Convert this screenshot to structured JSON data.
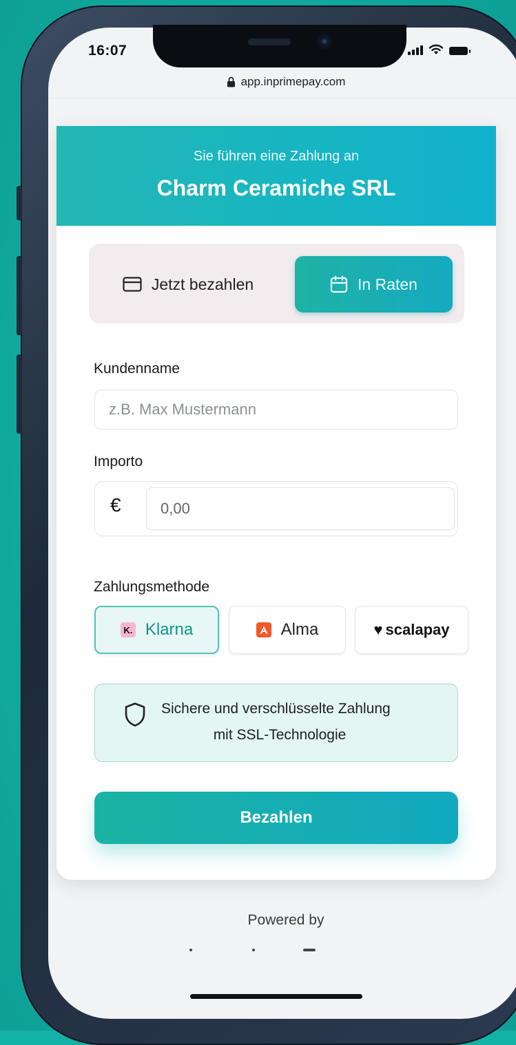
{
  "status_bar": {
    "time": "16:07"
  },
  "browser": {
    "url": "app.inprimepay.com"
  },
  "header": {
    "subtitle": "Sie führen eine Zahlung an",
    "merchant": "Charm Ceramiche SRL"
  },
  "payment_mode": {
    "options": [
      {
        "label": "Jetzt bezahlen",
        "icon": "credit-card-icon",
        "selected": false
      },
      {
        "label": "In Raten",
        "icon": "calendar-icon",
        "selected": true
      }
    ]
  },
  "form": {
    "customer_name": {
      "label": "Kundenname",
      "placeholder": "z.B. Max Mustermann",
      "value": ""
    },
    "amount": {
      "label": "Importo",
      "currency": "€",
      "placeholder": "0,00",
      "value": ""
    }
  },
  "payment_methods": {
    "label": "Zahlungsmethode",
    "options": [
      {
        "name": "Klarna",
        "logo": "K.",
        "selected": true
      },
      {
        "name": "Alma",
        "logo": "A",
        "selected": false
      },
      {
        "name": "scalapay",
        "logo": "♥",
        "selected": false
      }
    ]
  },
  "security": {
    "line1": "Sichere und verschlüsselte Zahlung",
    "line2": "mit SSL-Technologie"
  },
  "actions": {
    "pay_label": "Bezahlen"
  },
  "footer": {
    "powered_by": "Powered by"
  },
  "colors": {
    "background": "#14b1a6",
    "accent": "#17b3b8",
    "selected_method_text": "#149488",
    "secure_bg": "#e3f6f2"
  }
}
